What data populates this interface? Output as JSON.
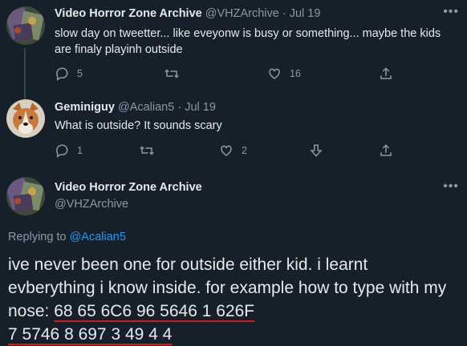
{
  "colors": {
    "background": "#15202b",
    "text": "#e7e9ea",
    "muted": "#8b98a5",
    "link": "#1d9bf0",
    "annotation": "#d11a1a"
  },
  "tweets": [
    {
      "name": "Video Horror Zone Archive",
      "handle": "@VHZArchive",
      "separator": "·",
      "date": "Jul 19",
      "text": "slow day on tweetter... like eveyonw is busy or something... maybe the kids are finaly playinh outside",
      "more_icon": "more-horizontal-icon",
      "actions": {
        "reply_count": "5",
        "retweet_count": "",
        "like_count": "16"
      }
    },
    {
      "name": "Geminiguy",
      "handle": "@Acalian5",
      "separator": "·",
      "date": "Jul 19",
      "text": "What is outside? It sounds scary",
      "actions": {
        "reply_count": "1",
        "retweet_count": "",
        "like_count": "2"
      }
    }
  ],
  "main_tweet": {
    "name": "Video Horror Zone Archive",
    "handle": "@VHZArchive",
    "more_icon": "more-horizontal-icon",
    "replying_prefix": "Replying to ",
    "replying_to": "@Acalian5",
    "text_plain": "ive never been one for outside either kid. i learnt evberything i know inside. for example how to type with my nose: ",
    "code_line1": "68 65 6C6  96 5646  1 626F",
    "code_line2": " 7  5746 8 697  3 49  4 4"
  }
}
